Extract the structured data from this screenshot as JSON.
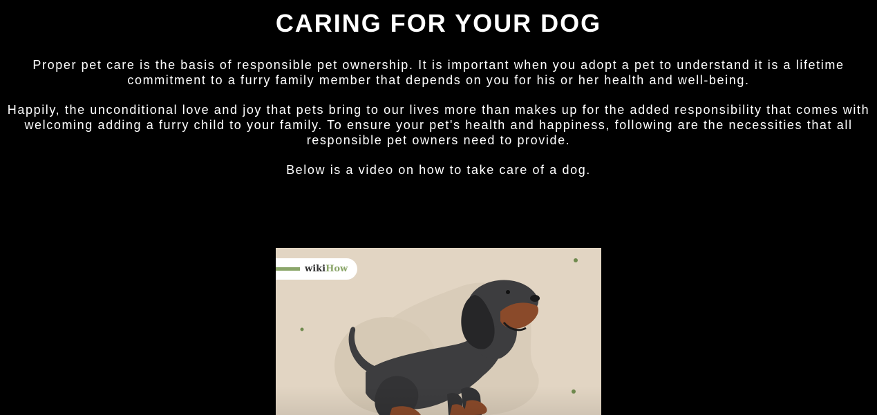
{
  "page": {
    "title": "CARING FOR YOUR DOG",
    "paragraphs": [
      "Proper pet care is the basis of responsible pet ownership. It is important when you adopt a pet to understand it is a lifetime commitment to a furry family member that depends on you for his or her health and well-being.",
      "Happily, the unconditional love and joy that pets bring to our lives more than makes up for the added responsibility that comes with welcoming adding a furry child to your family. To ensure your pet's health and happiness, following are the necessities that all responsible pet owners need to provide.",
      "Below is a video on how to take care of a dog."
    ]
  },
  "video": {
    "brand_wiki": "wiki",
    "brand_how": "How",
    "icon": "dog-illustration",
    "colors": {
      "background": "#e2d5c3",
      "brand_green": "#8ba66a",
      "dog_body": "#3d3d3f",
      "dog_tan": "#8a4a2a"
    }
  }
}
